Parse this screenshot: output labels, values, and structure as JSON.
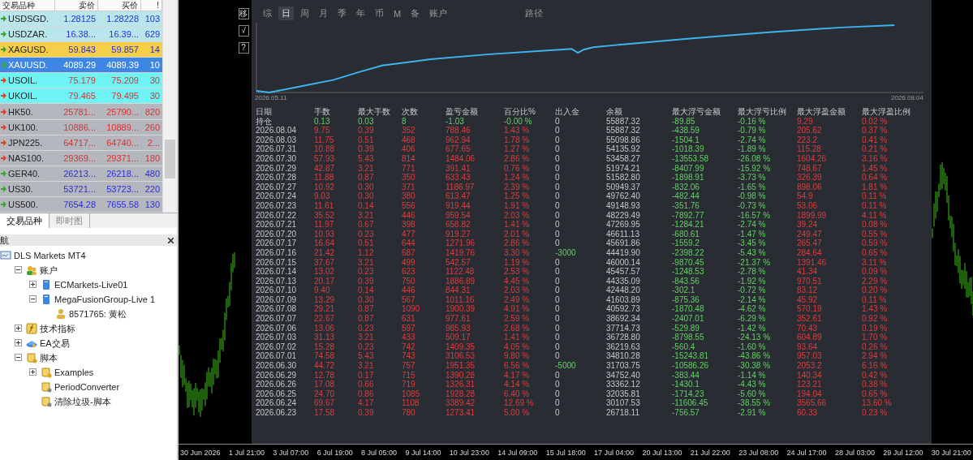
{
  "market_watch": {
    "columns": [
      "交易品种",
      "卖价",
      "买价",
      "!"
    ],
    "rows": [
      {
        "symbol": "USDSGD.",
        "bid": "1.28125",
        "ask": "1.28228",
        "spread": "103",
        "color": "#b8e6ea",
        "kind": "up",
        "selected": false
      },
      {
        "symbol": "USDZAR.",
        "bid": "16.38...",
        "ask": "16.39...",
        "spread": "629",
        "color": "#b8e6ea",
        "kind": "up",
        "selected": false
      },
      {
        "symbol": "XAGUSD.",
        "bid": "59.843",
        "ask": "59.857",
        "spread": "14",
        "color": "#f6cf4a",
        "kind": "up",
        "selected": false
      },
      {
        "symbol": "XAUUSD.",
        "bid": "4089.29",
        "ask": "4089.39",
        "spread": "10",
        "color": "#3d86e4",
        "kind": "up",
        "selected": true
      },
      {
        "symbol": "USOIL.",
        "bid": "75.179",
        "ask": "75.209",
        "spread": "30",
        "color": "#6ff4f6",
        "kind": "down",
        "selected": false
      },
      {
        "symbol": "UKOIL.",
        "bid": "79.465",
        "ask": "79.495",
        "spread": "30",
        "color": "#6ff4f6",
        "kind": "down",
        "selected": false
      },
      {
        "symbol": "HK50.",
        "bid": "25781...",
        "ask": "25790...",
        "spread": "820",
        "color": "#b4b7be",
        "kind": "down",
        "selected": false
      },
      {
        "symbol": "UK100.",
        "bid": "10886...",
        "ask": "10889...",
        "spread": "260",
        "color": "#b4b7be",
        "kind": "down",
        "selected": false
      },
      {
        "symbol": "JPN225.",
        "bid": "64717...",
        "ask": "64740...",
        "spread": "2...",
        "color": "#b4b7be",
        "kind": "down",
        "selected": false
      },
      {
        "symbol": "NAS100.",
        "bid": "29369...",
        "ask": "29371...",
        "spread": "180",
        "color": "#b4b7be",
        "kind": "down",
        "selected": false
      },
      {
        "symbol": "GER40.",
        "bid": "26213...",
        "ask": "26218...",
        "spread": "480",
        "color": "#b4b7be",
        "kind": "up",
        "selected": false
      },
      {
        "symbol": "US30.",
        "bid": "53721...",
        "ask": "53723...",
        "spread": "220",
        "color": "#b4b7be",
        "kind": "up",
        "selected": false
      },
      {
        "symbol": "US500.",
        "bid": "7654.28",
        "ask": "7655.58",
        "spread": "130",
        "color": "#b4b7be",
        "kind": "up",
        "selected": false
      }
    ],
    "tabs": [
      {
        "label": "交易品种",
        "selected": true
      },
      {
        "label": "即时图",
        "selected": false
      }
    ]
  },
  "navigator": {
    "title": "航",
    "tree": [
      {
        "label": "DLS Markets MT4",
        "kind": "terminal",
        "children": [
          {
            "label": "账户",
            "kind": "accounts",
            "expanded": true,
            "children": [
              {
                "label": "ECMarkets-Live01",
                "kind": "server",
                "expanded": false
              },
              {
                "label": "MegaFusionGroup-Live 1",
                "kind": "server",
                "expanded": true,
                "children": [
                  {
                    "label": "8571765: 黄松",
                    "kind": "account"
                  }
                ]
              }
            ]
          },
          {
            "label": "技术指标",
            "kind": "indicators",
            "expanded": false
          },
          {
            "label": "EA交易",
            "kind": "experts",
            "expanded": false
          },
          {
            "label": "脚本",
            "kind": "scripts",
            "expanded": true,
            "children": [
              {
                "label": "Examples",
                "kind": "scripts",
                "expanded": false
              },
              {
                "label": "PeriodConverter",
                "kind": "script"
              },
              {
                "label": "清除垃圾-脚本",
                "kind": "script"
              }
            ]
          }
        ]
      }
    ]
  },
  "report": {
    "tool_buttons": [
      "移",
      "√",
      "?"
    ],
    "tabs": [
      {
        "label": "综",
        "selected": false
      },
      {
        "label": "日",
        "selected": true
      },
      {
        "label": "周",
        "selected": false
      },
      {
        "label": "月",
        "selected": false
      },
      {
        "label": "季",
        "selected": false
      },
      {
        "label": "年",
        "selected": false
      },
      {
        "label": "币",
        "selected": false
      },
      {
        "label": "M",
        "selected": false
      },
      {
        "label": "备",
        "selected": false
      },
      {
        "label": "账户",
        "selected": false
      }
    ],
    "path_label": "路径",
    "chart": {
      "start_date": "2026.05.11",
      "end_date": "2026.08.04"
    },
    "table": {
      "columns": [
        {
          "label": "日期",
          "kind": "date"
        },
        {
          "label": "手数",
          "kind": "result"
        },
        {
          "label": "最大手数",
          "kind": "result"
        },
        {
          "label": "次数",
          "kind": "result"
        },
        {
          "label": "盈亏金额",
          "kind": "result"
        },
        {
          "label": "百分比%",
          "kind": "result"
        },
        {
          "label": "出入金",
          "kind": "cash"
        },
        {
          "label": "余额",
          "kind": "balance"
        },
        {
          "label": "最大浮亏金额",
          "kind": "drawdown"
        },
        {
          "label": "最大浮亏比例",
          "kind": "drawdown"
        },
        {
          "label": "最大浮盈金额",
          "kind": "runup"
        },
        {
          "label": "最大浮盈比例",
          "kind": "runup"
        }
      ],
      "rows": [
        {
          "kind": "loss",
          "cash_out": false,
          "cells": [
            "持仓",
            "0.13",
            "0.03",
            "8",
            "-1.03",
            "-0.00 %",
            "0",
            "55887.32",
            "-89.85",
            "-0.16 %",
            "9.29",
            "0.02 %"
          ]
        },
        {
          "kind": "profit",
          "cash_out": false,
          "cells": [
            "2026.08.04",
            "9.75",
            "0.39",
            "352",
            "788.46",
            "1.43 %",
            "0",
            "55887.32",
            "-438.59",
            "-0.79 %",
            "205.62",
            "0.37 %"
          ]
        },
        {
          "kind": "profit",
          "cash_out": false,
          "cells": [
            "2026.08.03",
            "11.75",
            "0.51",
            "468",
            "962.94",
            "1.78 %",
            "0",
            "55098.86",
            "-1504.1",
            "-2.74 %",
            "223.2",
            "0.41 %"
          ]
        },
        {
          "kind": "profit",
          "cash_out": false,
          "cells": [
            "2026.07.31",
            "10.88",
            "0.39",
            "406",
            "677.65",
            "1.27 %",
            "0",
            "54135.92",
            "-1018.39",
            "-1.89 %",
            "115.28",
            "0.21 %"
          ]
        },
        {
          "kind": "profit",
          "cash_out": false,
          "cells": [
            "2026.07.30",
            "57.93",
            "5.43",
            "814",
            "1484.06",
            "2.86 %",
            "0",
            "53458.27",
            "-13553.58",
            "-26.08 %",
            "1604.26",
            "3.16 %"
          ]
        },
        {
          "kind": "profit",
          "cash_out": false,
          "cells": [
            "2026.07.29",
            "42.87",
            "3.21",
            "771",
            "391.41",
            "0.76 %",
            "0",
            "51974.21",
            "-8407.99",
            "-15.92 %",
            "748.67",
            "1.45 %"
          ]
        },
        {
          "kind": "profit",
          "cash_out": false,
          "cells": [
            "2026.07.28",
            "11.88",
            "0.87",
            "350",
            "633.43",
            "1.24 %",
            "0",
            "51582.80",
            "-1898.91",
            "-3.73 %",
            "326.39",
            "0.64 %"
          ]
        },
        {
          "kind": "profit",
          "cash_out": false,
          "cells": [
            "2026.07.27",
            "10.92",
            "0.30",
            "371",
            "1186.97",
            "2.39 %",
            "0",
            "50949.37",
            "-832.06",
            "-1.65 %",
            "898.06",
            "1.81 %"
          ]
        },
        {
          "kind": "profit",
          "cash_out": false,
          "cells": [
            "2026.07.24",
            "9.03",
            "0.30",
            "380",
            "613.47",
            "1.25 %",
            "0",
            "49762.40",
            "-482.44",
            "-0.98 %",
            "54.9",
            "0.11 %"
          ]
        },
        {
          "kind": "profit",
          "cash_out": false,
          "cells": [
            "2026.07.23",
            "11.61",
            "0.14",
            "556",
            "919.44",
            "1.91 %",
            "0",
            "49148.93",
            "-351.76",
            "-0.73 %",
            "53.06",
            "0.11 %"
          ]
        },
        {
          "kind": "profit",
          "cash_out": false,
          "cells": [
            "2026.07.22",
            "35.52",
            "3.21",
            "446",
            "959.54",
            "2.03 %",
            "0",
            "48229.49",
            "-7892.77",
            "-16.57 %",
            "1899.99",
            "4.11 %"
          ]
        },
        {
          "kind": "profit",
          "cash_out": false,
          "cells": [
            "2026.07.21",
            "11.97",
            "0.67",
            "398",
            "658.82",
            "1.41 %",
            "0",
            "47269.95",
            "-1284.21",
            "-2.74 %",
            "39.24",
            "0.08 %"
          ]
        },
        {
          "kind": "profit",
          "cash_out": false,
          "cells": [
            "2026.07.20",
            "10.93",
            "0.23",
            "477",
            "919.27",
            "2.01 %",
            "0",
            "46611.13",
            "-680.61",
            "-1.47 %",
            "249.47",
            "0.55 %"
          ]
        },
        {
          "kind": "profit",
          "cash_out": false,
          "cells": [
            "2026.07.17",
            "16.64",
            "0.51",
            "644",
            "1271.96",
            "2.86 %",
            "0",
            "45691.86",
            "-1559.2",
            "-3.45 %",
            "265.47",
            "0.59 %"
          ]
        },
        {
          "kind": "profit",
          "cash_out": true,
          "cells": [
            "2026.07.16",
            "21.42",
            "1.12",
            "687",
            "1419.76",
            "3.30 %",
            "-3000",
            "44419.90",
            "-2398.22",
            "-5.43 %",
            "284.64",
            "0.65 %"
          ]
        },
        {
          "kind": "profit",
          "cash_out": false,
          "cells": [
            "2026.07.15",
            "37.67",
            "3.21",
            "499",
            "542.57",
            "1.19 %",
            "0",
            "46000.14",
            "-9870.45",
            "-21.37 %",
            "1391.46",
            "3.11 %"
          ]
        },
        {
          "kind": "profit",
          "cash_out": false,
          "cells": [
            "2026.07.14",
            "13.02",
            "0.23",
            "623",
            "1122.48",
            "2.53 %",
            "0",
            "45457.57",
            "-1248.53",
            "-2.78 %",
            "41.34",
            "0.09 %"
          ]
        },
        {
          "kind": "profit",
          "cash_out": false,
          "cells": [
            "2026.07.13",
            "20.17",
            "0.39",
            "750",
            "1886.89",
            "4.45 %",
            "0",
            "44335.09",
            "-843.56",
            "-1.92 %",
            "970.51",
            "2.29 %"
          ]
        },
        {
          "kind": "profit",
          "cash_out": false,
          "cells": [
            "2026.07.10",
            "9.40",
            "0.14",
            "446",
            "844.31",
            "2.03 %",
            "0",
            "42448.20",
            "-302.1",
            "-0.72 %",
            "83.12",
            "0.20 %"
          ]
        },
        {
          "kind": "profit",
          "cash_out": false,
          "cells": [
            "2026.07.09",
            "13.29",
            "0.30",
            "567",
            "1011.16",
            "2.49 %",
            "0",
            "41603.89",
            "-875.36",
            "-2.14 %",
            "45.92",
            "0.11 %"
          ]
        },
        {
          "kind": "profit",
          "cash_out": false,
          "cells": [
            "2026.07.08",
            "29.21",
            "0.87",
            "1090",
            "1900.39",
            "4.91 %",
            "0",
            "40592.73",
            "-1870.48",
            "-4.62 %",
            "570.19",
            "1.43 %"
          ]
        },
        {
          "kind": "profit",
          "cash_out": false,
          "cells": [
            "2026.07.07",
            "22.67",
            "0.87",
            "631",
            "977.61",
            "2.59 %",
            "0",
            "38692.34",
            "-2407.01",
            "-6.29 %",
            "352.61",
            "0.92 %"
          ]
        },
        {
          "kind": "profit",
          "cash_out": false,
          "cells": [
            "2026.07.06",
            "13.06",
            "0.23",
            "597",
            "985.93",
            "2.68 %",
            "0",
            "37714.73",
            "-529.89",
            "-1.42 %",
            "70.43",
            "0.19 %"
          ]
        },
        {
          "kind": "profit",
          "cash_out": false,
          "cells": [
            "2026.07.03",
            "31.13",
            "3.21",
            "433",
            "509.17",
            "1.41 %",
            "0",
            "36728.80",
            "-8798.55",
            "-24.13 %",
            "604.89",
            "1.70 %"
          ]
        },
        {
          "kind": "profit",
          "cash_out": false,
          "cells": [
            "2026.07.02",
            "15.28",
            "0.23",
            "742",
            "1409.35",
            "4.05 %",
            "0",
            "36219.63",
            "-560.4",
            "-1.60 %",
            "93.64",
            "0.26 %"
          ]
        },
        {
          "kind": "profit",
          "cash_out": false,
          "cells": [
            "2026.07.01",
            "74.58",
            "5.43",
            "743",
            "3106.53",
            "9.80 %",
            "0",
            "34810.28",
            "-15243.81",
            "-43.86 %",
            "957.03",
            "2.94 %"
          ]
        },
        {
          "kind": "profit",
          "cash_out": true,
          "cells": [
            "2026.06.30",
            "44.72",
            "3.21",
            "757",
            "1951.35",
            "6.56 %",
            "-5000",
            "31703.75",
            "-10586.26",
            "-30.38 %",
            "2053.2",
            "6.16 %"
          ]
        },
        {
          "kind": "profit",
          "cash_out": false,
          "cells": [
            "2026.06.29",
            "12.78",
            "0.17",
            "715",
            "1390.28",
            "4.17 %",
            "0",
            "34752.40",
            "-383.44",
            "-1.14 %",
            "140.34",
            "0.42 %"
          ]
        },
        {
          "kind": "profit",
          "cash_out": false,
          "cells": [
            "2026.06.26",
            "17.08",
            "0.66",
            "719",
            "1326.31",
            "4.14 %",
            "0",
            "33362.12",
            "-1430.1",
            "-4.43 %",
            "123.21",
            "0.38 %"
          ]
        },
        {
          "kind": "profit",
          "cash_out": false,
          "cells": [
            "2026.06.25",
            "24.70",
            "0.86",
            "1085",
            "1928.28",
            "6.40 %",
            "0",
            "32035.81",
            "-1714.23",
            "-5.60 %",
            "194.04",
            "0.65 %"
          ]
        },
        {
          "kind": "profit",
          "cash_out": false,
          "cells": [
            "2026.06.24",
            "69.67",
            "4.17",
            "1108",
            "3389.42",
            "12.69 %",
            "0",
            "30107.53",
            "-11606.45",
            "-38.55 %",
            "3565.66",
            "13.60 %"
          ]
        },
        {
          "kind": "profit",
          "cash_out": false,
          "cells": [
            "2026.06.23",
            "17.58",
            "0.39",
            "780",
            "1273.41",
            "5.00 %",
            "0",
            "26718.11",
            "-756.57",
            "-2.91 %",
            "60.33",
            "0.23 %"
          ]
        }
      ]
    }
  },
  "time_axis": [
    "30 Jun 2026",
    "1 Jul 21:00",
    "3 Jul 07:00",
    "6 Jul 19:00",
    "8 Jul 05:00",
    "9 Jul 14:00",
    "10 Jul 23:00",
    "14 Jul 09:00",
    "15 Jul 18:00",
    "17 Jul 04:00",
    "20 Jul 13:00",
    "21 Jul 22:00",
    "23 Jul 08:00",
    "24 Jul 17:00",
    "28 Jul 03:00",
    "29 Jul 12:00",
    "30 Jul 21:00"
  ]
}
